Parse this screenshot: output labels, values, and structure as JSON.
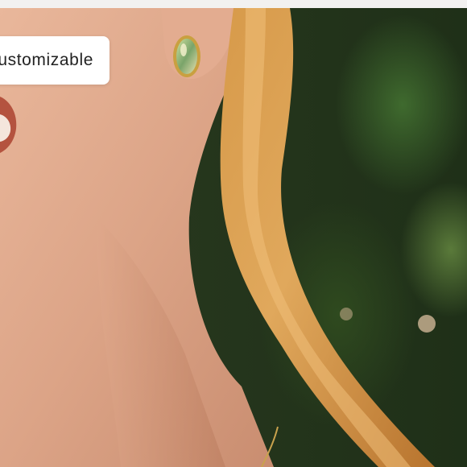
{
  "badge": {
    "label": "ustomizable"
  },
  "image": {
    "subject": "woman-with-earring-photo"
  }
}
